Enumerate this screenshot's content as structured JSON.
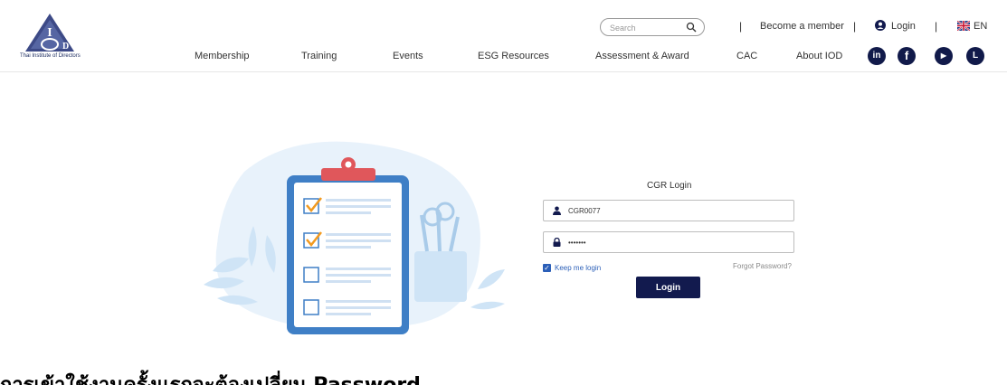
{
  "header": {
    "logo_subtitle": "Thai Institute of Directors",
    "search_placeholder": "Search",
    "become_member": "Become a member",
    "login": "Login",
    "language": "EN",
    "separator": "|"
  },
  "nav": {
    "items": [
      "Membership",
      "Training",
      "Events",
      "ESG Resources",
      "Assessment & Award",
      "CAC",
      "About IOD"
    ]
  },
  "social": {
    "linkedin": "in",
    "facebook": "f",
    "youtube": "▶",
    "line": "L"
  },
  "login_form": {
    "title": "CGR Login",
    "username_value": "CGR0077",
    "password_value": "•••••••",
    "keep_me_login": "Keep me login",
    "forgot_password": "Forgot Password?",
    "login_button": "Login"
  },
  "footer_text": "การเข้าใช้งานครั้งแรกจะต้องเปลี่ยน Password",
  "colors": {
    "brand_navy": "#121a4e",
    "link_blue": "#2b5fb8",
    "clipboard_blue": "#3f7fc6",
    "clip_red": "#e0575b",
    "check_orange": "#f29a1f"
  }
}
